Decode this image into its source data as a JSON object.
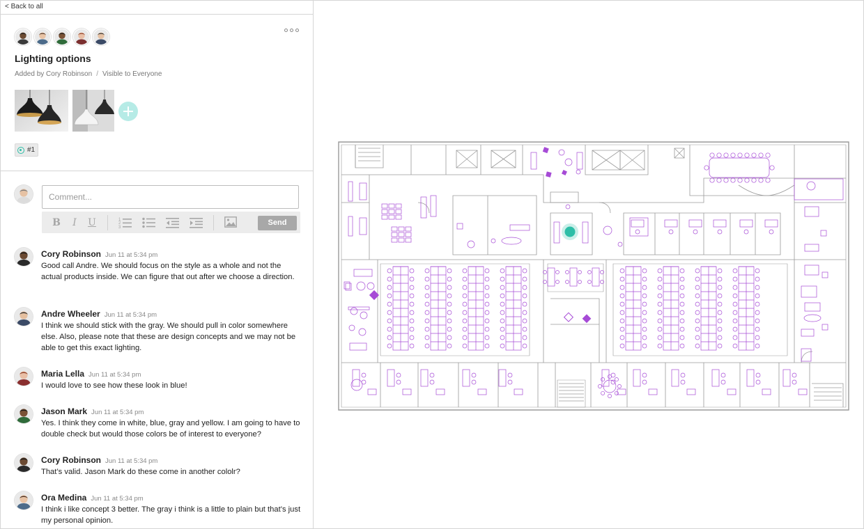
{
  "nav": {
    "back_label": "< Back to all"
  },
  "item": {
    "title": "Lighting options",
    "added_by": "Added by Cory Robinson",
    "visibility": "Visible to Everyone",
    "pin_label": "#1",
    "collaborators": [
      {
        "name": "collaborator-1",
        "skin": "#6b4a32",
        "shirt": "#3a3a3a",
        "hair": "#1c1c1c"
      },
      {
        "name": "collaborator-2",
        "skin": "#e8c3a5",
        "shirt": "#4c6b8a",
        "hair": "#4a3022"
      },
      {
        "name": "collaborator-3",
        "skin": "#7a5236",
        "shirt": "#2f6b3a",
        "hair": "#1a1a1a"
      },
      {
        "name": "collaborator-4",
        "skin": "#e9bfa6",
        "shirt": "#7b2f2f",
        "hair": "#8a3a22"
      },
      {
        "name": "collaborator-5",
        "skin": "#e6c2a4",
        "shirt": "#3b4a66",
        "hair": "#2a2a2a"
      }
    ]
  },
  "composer": {
    "placeholder": "Comment...",
    "send_label": "Send",
    "tools": [
      "bold-icon",
      "italic-icon",
      "underline-icon",
      "numbered-list-icon",
      "bullet-list-icon",
      "outdent-icon",
      "indent-icon",
      "image-icon"
    ]
  },
  "comments": [
    {
      "name": "Cory Robinson",
      "time": "Jun 11 at 5:34 pm",
      "text": "Good call Andre. We should focus on the style as a whole and not the actual products inside. We can figure that out after we choose a direction.",
      "skin": "#6b4a32",
      "shirt": "#2a2a2a",
      "hair": "#141414"
    },
    {
      "name": "Andre Wheeler",
      "time": "Jun 11 at 5:34 pm",
      "text": "I think we should stick with the gray. We should pull in color somewhere else. Also, please note that these are design concepts and we may not be able to get this exact lighting.",
      "skin": "#e4bf9f",
      "shirt": "#3b4a66",
      "hair": "#2a2a2a"
    },
    {
      "name": "Maria Lella",
      "time": "Jun 11 at 5:34 pm",
      "text": "I would love to see how these look in blue!",
      "skin": "#e9bfa6",
      "shirt": "#8a2f2f",
      "hair": "#8a3a22"
    },
    {
      "name": "Jason Mark",
      "time": "Jun 11 at 5:34 pm",
      "text": "Yes. I think they come in white, blue, gray and yellow. I am going to have to double check but would those colors be of interest to everyone?",
      "skin": "#7a5236",
      "shirt": "#2f6b3a",
      "hair": "#1a1a1a"
    },
    {
      "name": "Cory Robinson",
      "time": "Jun 11 at 5:34 pm",
      "text": "That’s valid. Jason Mark do these come in another cololr?",
      "skin": "#6b4a32",
      "shirt": "#2a2a2a",
      "hair": "#141414"
    },
    {
      "name": "Ora Medina",
      "time": "Jun 11 at 5:34 pm",
      "text": "I think i like concept 3 better. The gray i think is a little to plain but that’s just my personal opinion.",
      "skin": "#e8c3a5",
      "shirt": "#4c6b8a",
      "hair": "#4a3022"
    }
  ],
  "theme": {
    "accent": "#2dbea7",
    "add_button": "#b6ebe6",
    "plan_line": "#9a9a9a",
    "plan_furniture": "#a64bd6",
    "send_bg": "#a8a8a8"
  }
}
